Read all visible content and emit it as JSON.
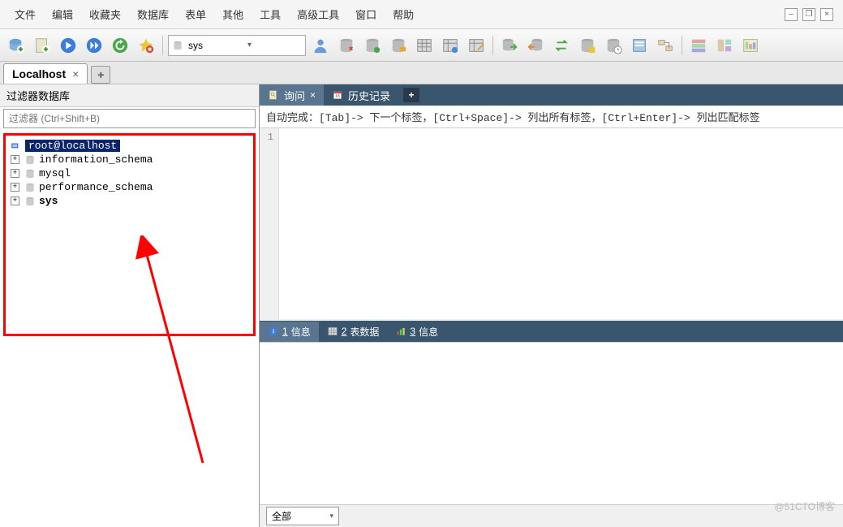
{
  "menu": {
    "items": [
      "文件",
      "编辑",
      "收藏夹",
      "数据库",
      "表单",
      "其他",
      "工具",
      "高级工具",
      "窗口",
      "帮助"
    ]
  },
  "toolbar": {
    "db_selected": "sys"
  },
  "conn_tab": {
    "label": "Localhost"
  },
  "sidebar": {
    "filter_title": "过滤器数据库",
    "filter_placeholder": "过滤器 (Ctrl+Shift+B)",
    "root": "root@localhost",
    "databases": [
      "information_schema",
      "mysql",
      "performance_schema",
      "sys"
    ]
  },
  "query_tabs": {
    "query": "询问",
    "history": "历史记录"
  },
  "hint": "自动完成：[Tab]-> 下一个标签，[Ctrl+Space]-> 列出所有标签，[Ctrl+Enter]-> 列出匹配标签",
  "gutter_line": "1",
  "result_tabs": {
    "t1_num": "1",
    "t1_label": "信息",
    "t2_num": "2",
    "t2_label": "表数据",
    "t3_num": "3",
    "t3_label": "信息"
  },
  "status": {
    "filter": "全部"
  },
  "watermark": "@51CTO博客"
}
